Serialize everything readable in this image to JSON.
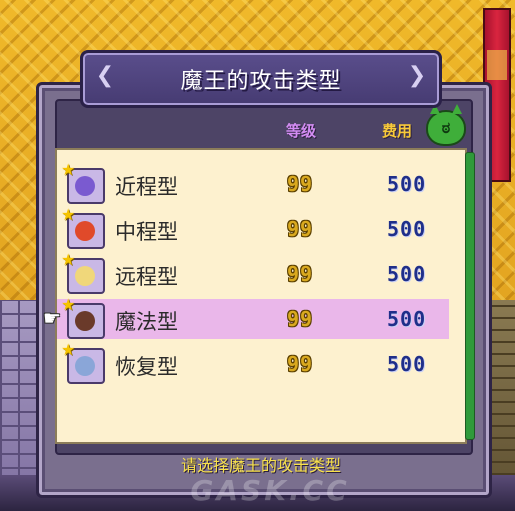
{
  "title": "魔王的攻击类型",
  "columns": {
    "level": "等级",
    "cost": "费用"
  },
  "rows": [
    {
      "name": "近程型",
      "level": "99",
      "cost": "500",
      "selected": false,
      "face_color": "#7a5ad0",
      "star": "★"
    },
    {
      "name": "中程型",
      "level": "99",
      "cost": "500",
      "selected": false,
      "face_color": "#e04a2a",
      "star": "★"
    },
    {
      "name": "远程型",
      "level": "99",
      "cost": "500",
      "selected": false,
      "face_color": "#f0d77a",
      "star": "★"
    },
    {
      "name": "魔法型",
      "level": "99",
      "cost": "500",
      "selected": true,
      "face_color": "#6a3a2a",
      "star": "★"
    },
    {
      "name": "恢复型",
      "level": "99",
      "cost": "500",
      "selected": false,
      "face_color": "#8aa6d8",
      "star": "★"
    }
  ],
  "prompt": "请选择魔王的攻击类型",
  "watermark": "GASK.CC",
  "icons": {
    "cursor": "pointing-hand-icon",
    "cost_icon": "demon-head-icon",
    "star": "star-icon"
  },
  "colors": {
    "selected_row": "#eab7ea",
    "level_header": "#d28cf2",
    "cost_header": "#f7c93a"
  }
}
